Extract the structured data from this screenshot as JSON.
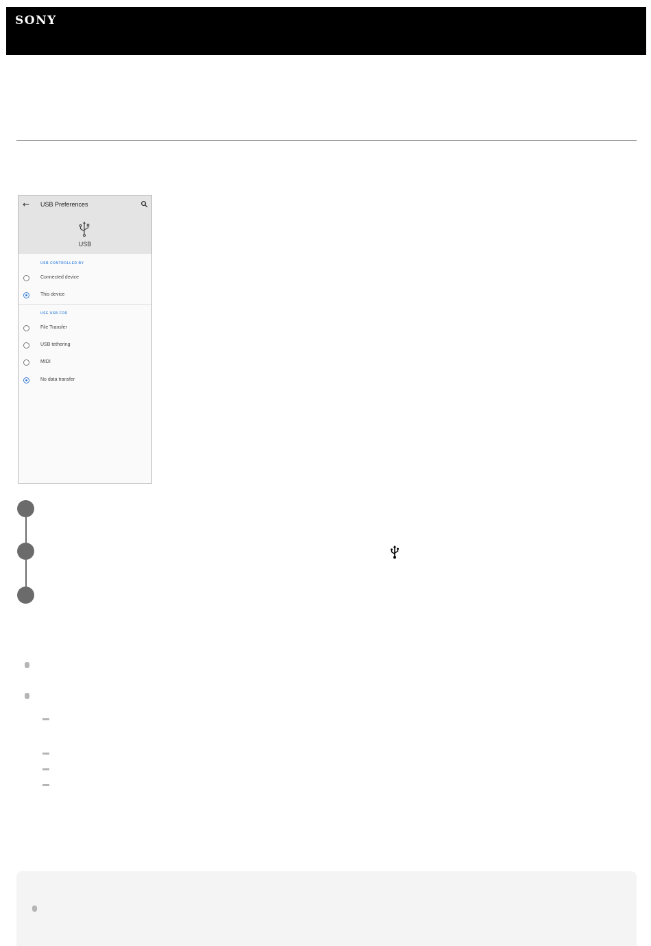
{
  "header": {
    "logo": "SONY"
  },
  "phone": {
    "title": "USB Preferences",
    "usb_label": "USB",
    "section_controlled": "USB CONTROLLED BY",
    "controlled_options": [
      {
        "label": "Connected device",
        "selected": false
      },
      {
        "label": "This device",
        "selected": true
      }
    ],
    "section_use": "USE USB FOR",
    "use_options": [
      {
        "label": "File Transfer",
        "selected": false
      },
      {
        "label": "USB tethering",
        "selected": false
      },
      {
        "label": "MIDI",
        "selected": false
      },
      {
        "label": "No data transfer",
        "selected": true
      }
    ]
  },
  "icons": {
    "back": "back-arrow-icon",
    "search": "search-icon",
    "usb": "usb-icon"
  },
  "colors": {
    "header_bg": "#000000",
    "accent_blue": "#4a90e2",
    "step_gray": "#6b6b6b",
    "bullet_gray": "#b5b5b5",
    "note_bg": "#f4f4f4"
  }
}
